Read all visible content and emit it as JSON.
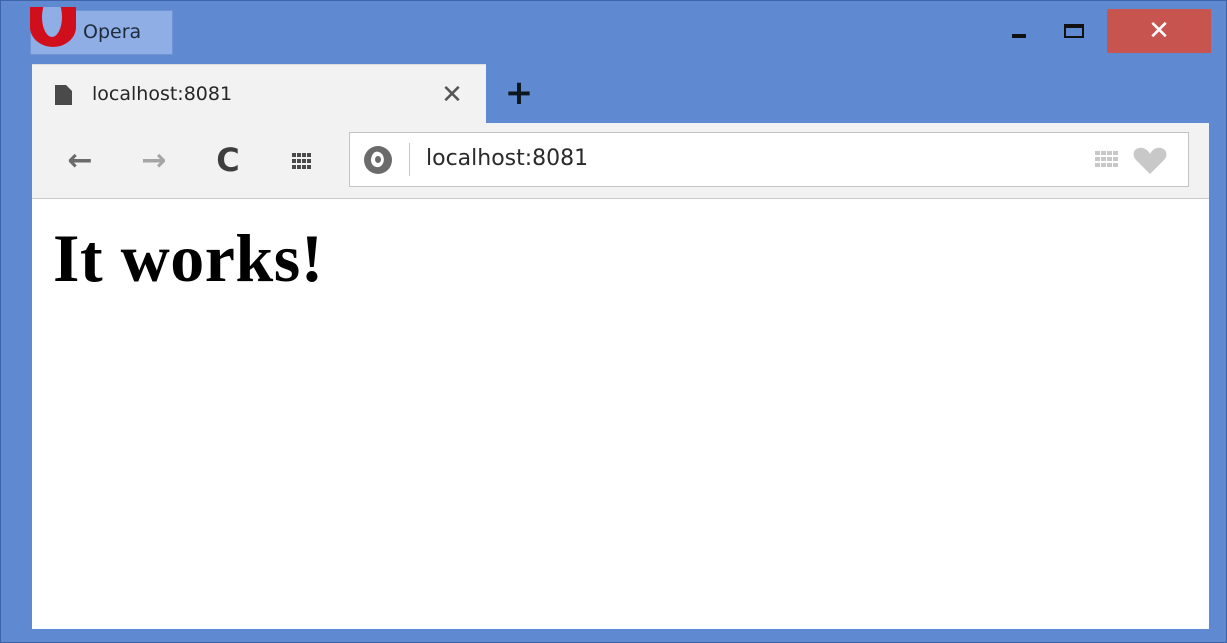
{
  "app": {
    "menu_label": "Opera",
    "accent_color": "#5f89d1",
    "close_button_color": "#c85450",
    "logo_color": "#d10e1c"
  },
  "window_controls": {
    "minimize_icon": "minimize-icon",
    "maximize_icon": "maximize-icon",
    "close_glyph": "✕"
  },
  "tabs": [
    {
      "title": "localhost:8081",
      "icon": "document-icon",
      "close_glyph": "✕",
      "active": true
    }
  ],
  "new_tab_glyph": "+",
  "toolbar": {
    "back_glyph": "←",
    "forward_glyph": "→",
    "reload_glyph": "C",
    "speed_dial_icon": "grid-icon"
  },
  "address_bar": {
    "value": "localhost:8081",
    "site_icon": "globe-icon",
    "right_icons": [
      "grid-icon",
      "heart-icon"
    ]
  },
  "page": {
    "heading": "It works!"
  }
}
